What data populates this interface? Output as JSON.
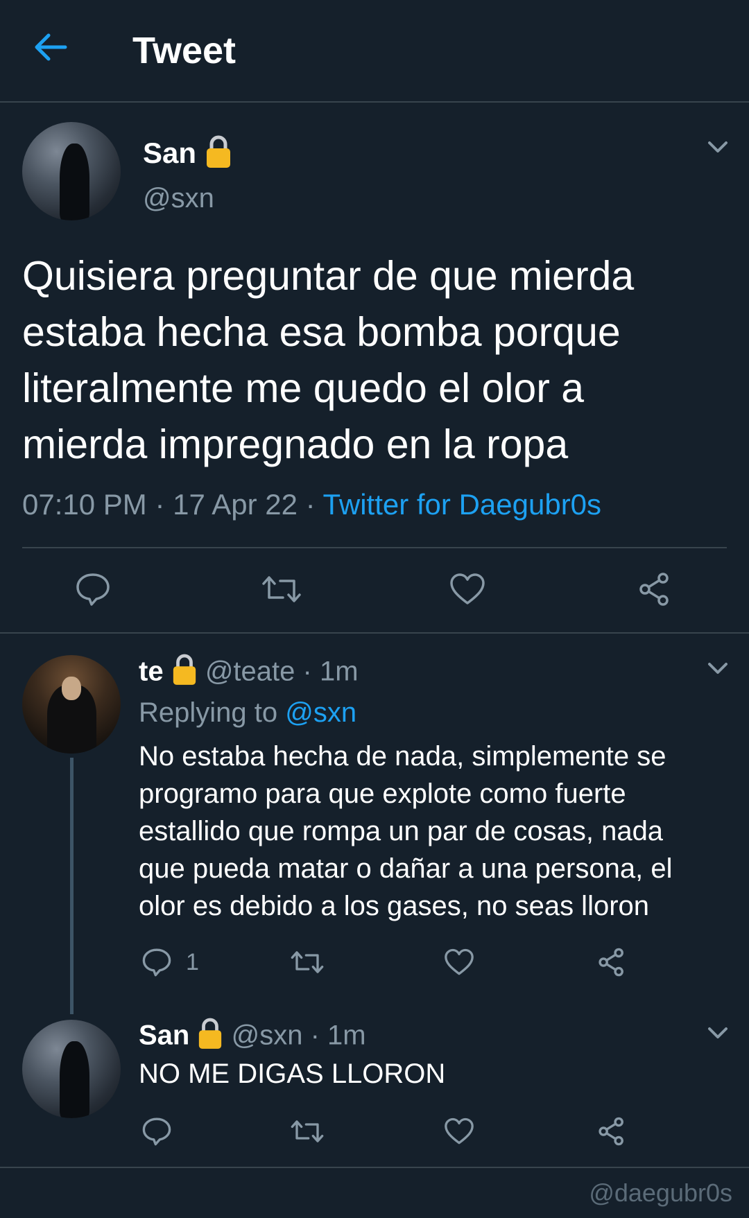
{
  "header": {
    "title": "Tweet"
  },
  "main_tweet": {
    "display_name": "San",
    "handle": "@sxn",
    "text_lines": [
      "Quisiera preguntar de que mierda",
      "estaba hecha esa bomba porque",
      "literalmente me quedo el olor a",
      "mierda impregnado en la ropa"
    ],
    "time": "07:10 PM",
    "sep": "·",
    "date": "17 Apr 22",
    "source": "Twitter for Daegubr0s"
  },
  "reply1": {
    "display_name": "te",
    "handle": "@teate",
    "sep": "·",
    "age": "1m",
    "replying_label": "Replying to",
    "replying_handle": "@sxn",
    "text_lines": [
      "No estaba hecha de nada, simplemente se",
      "programo para que explote como fuerte",
      "estallido que rompa un par de cosas, nada",
      "que pueda matar o dañar a una persona, el",
      "olor es debido a los gases, no seas lloron"
    ],
    "reply_count": "1"
  },
  "reply2": {
    "display_name": "San",
    "handle": "@sxn",
    "sep": "·",
    "age": "1m",
    "text": "NO ME DIGAS LLORON"
  },
  "watermark": "@daegubr0s",
  "colors": {
    "background": "#15202b",
    "accent": "#1da1f2",
    "muted": "#8899a6",
    "divider": "#38444d",
    "lock": "#f5b921"
  },
  "icons": [
    "back-arrow-icon",
    "chevron-down-icon",
    "lock-icon",
    "reply-icon",
    "retweet-icon",
    "like-icon",
    "share-icon"
  ]
}
